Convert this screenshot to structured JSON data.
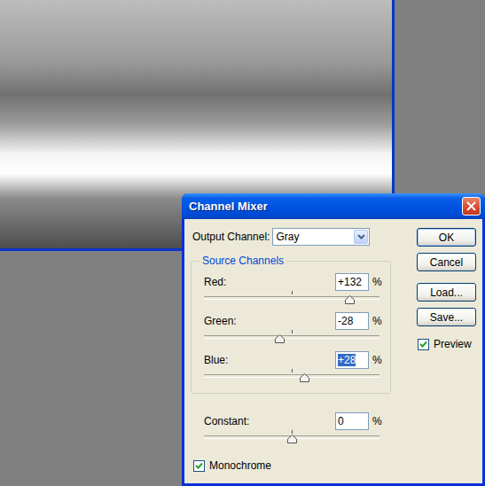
{
  "window": {
    "title": "Channel Mixer"
  },
  "output_channel": {
    "label": "Output Channel:",
    "value": "Gray"
  },
  "source_channels": {
    "title": "Source Channels",
    "channels": [
      {
        "name": "Red:",
        "value": "+132",
        "unit": "%",
        "level": 0.83,
        "selected": false
      },
      {
        "name": "Green:",
        "value": "-28",
        "unit": "%",
        "level": 0.43,
        "selected": false
      },
      {
        "name": "Blue:",
        "value": "+28",
        "unit": "%",
        "level": 0.57,
        "selected": true
      }
    ]
  },
  "constant": {
    "label": "Constant:",
    "value": "0",
    "unit": "%",
    "level": 0.5
  },
  "monochrome": {
    "label": "Monochrome",
    "checked": true
  },
  "preview": {
    "label": "Preview",
    "checked": true
  },
  "buttons": [
    {
      "label": "OK",
      "default": true
    },
    {
      "label": "Cancel",
      "default": false
    },
    {
      "label": "Load...",
      "default": false
    },
    {
      "label": "Save...",
      "default": false
    }
  ]
}
